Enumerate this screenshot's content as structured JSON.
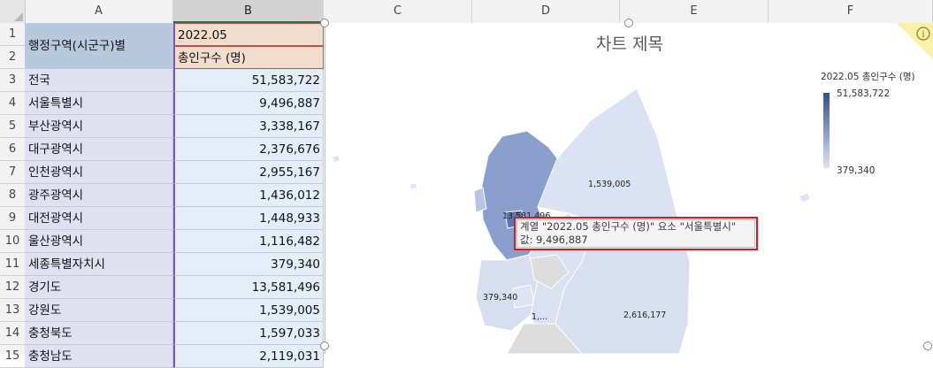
{
  "columns": [
    "A",
    "B",
    "C",
    "D",
    "E",
    "F"
  ],
  "rows": [
    "1",
    "2",
    "3",
    "4",
    "5",
    "6",
    "7",
    "8",
    "9",
    "10",
    "11",
    "12",
    "13",
    "14",
    "15"
  ],
  "header": {
    "region_label": "행정구역(시군구)별",
    "period": "2022.05",
    "measure": "총인구수 (명)"
  },
  "table": [
    {
      "region": "전국",
      "value": "51,583,722"
    },
    {
      "region": "서울특별시",
      "value": "9,496,887"
    },
    {
      "region": "부산광역시",
      "value": "3,338,167"
    },
    {
      "region": "대구광역시",
      "value": "2,376,676"
    },
    {
      "region": "인천광역시",
      "value": "2,955,167"
    },
    {
      "region": "광주광역시",
      "value": "1,436,012"
    },
    {
      "region": "대전광역시",
      "value": "1,448,933"
    },
    {
      "region": "울산광역시",
      "value": "1,116,482"
    },
    {
      "region": "세종특별자치시",
      "value": "379,340"
    },
    {
      "region": "경기도",
      "value": "13,581,496"
    },
    {
      "region": "강원도",
      "value": "1,539,005"
    },
    {
      "region": "충청북도",
      "value": "1,597,033"
    },
    {
      "region": "충청남도",
      "value": "2,119,031"
    }
  ],
  "chart": {
    "title": "차트 제목",
    "legend_title": "2022.05 총인구수 (명)",
    "legend_max": "51,583,722",
    "legend_min": "379,340",
    "map_labels": {
      "gangwon": "1,539,005",
      "gyeonggi": "13,581,496",
      "sejong": "379,340",
      "chungbuk_partial": "1,...",
      "gyeongbuk": "2,616,177"
    },
    "tooltip_line1": "계열 \"2022.05 총인구수 (명)\" 요소 \"서울특별시\"",
    "tooltip_line2": "값: 9,496,887",
    "colors": {
      "max": "#2e4f92",
      "min": "#dde4f5",
      "other": "#dcdcdc"
    }
  }
}
